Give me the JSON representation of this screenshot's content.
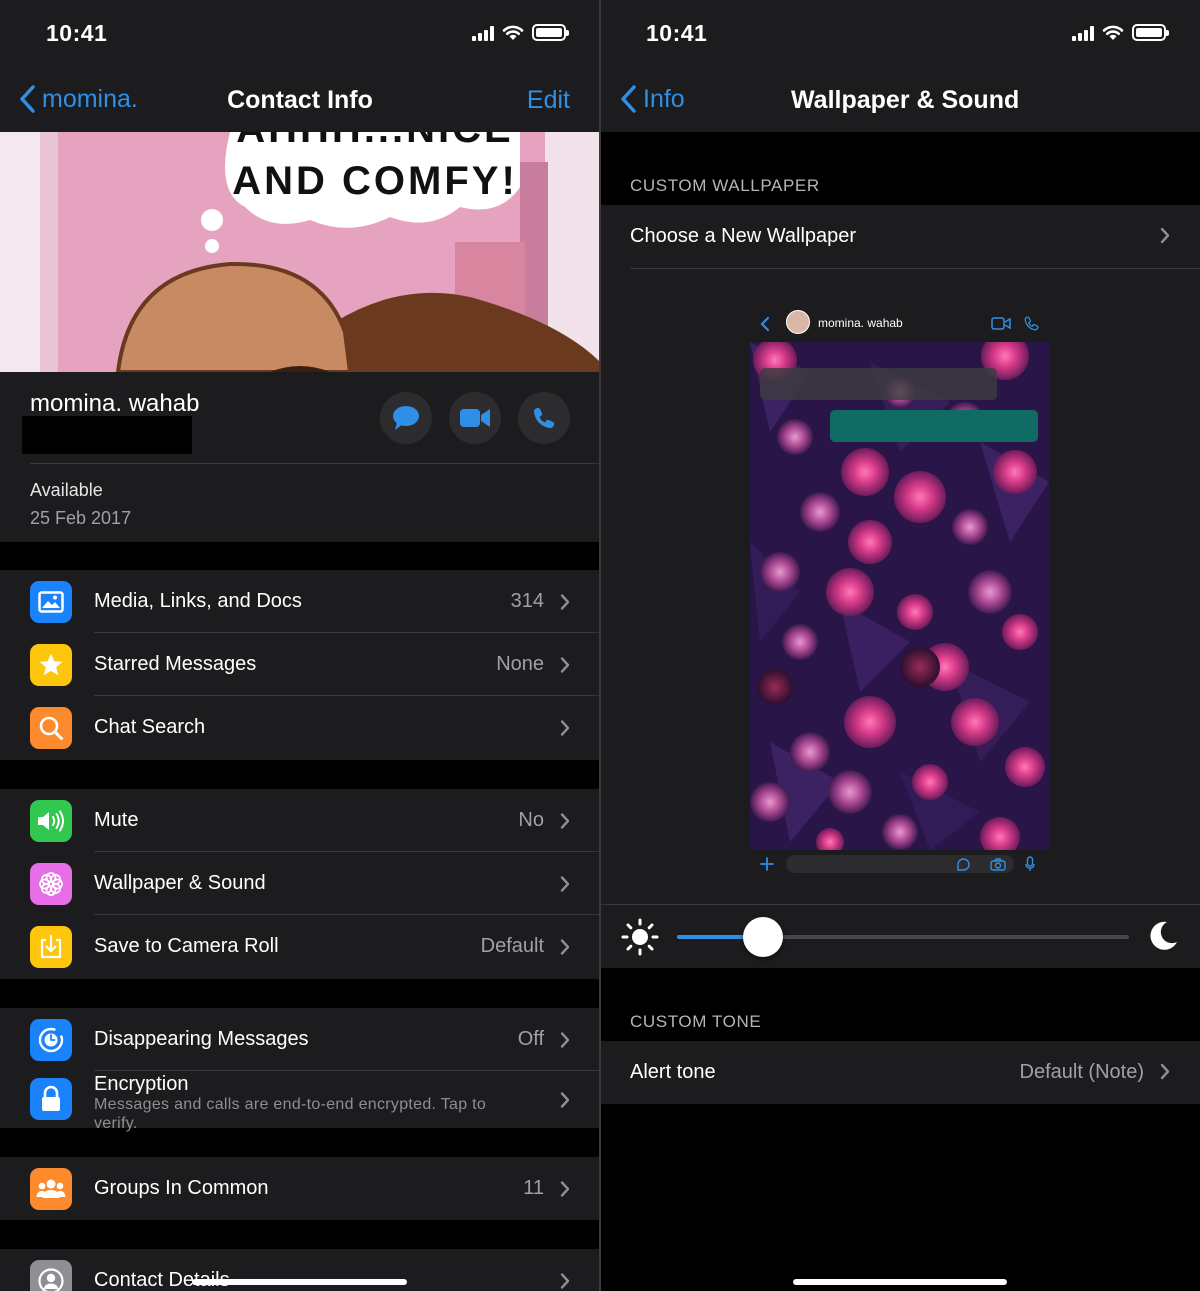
{
  "left": {
    "status": {
      "time": "10:41"
    },
    "nav": {
      "back_label": "momina.",
      "title": "Contact Info",
      "edit_label": "Edit"
    },
    "profile_image": {
      "caption_line1": "AHHH...NICE",
      "caption_line2": "AND COMFY!"
    },
    "contact": {
      "name": "momina. wahab",
      "status": "Available",
      "status_date": "25 Feb 2017"
    },
    "groups": [
      [
        {
          "icon": "photo-icon",
          "color": "#1a82fb",
          "label": "Media, Links, and Docs",
          "value": "314"
        },
        {
          "icon": "star-icon",
          "color": "#fdc50b",
          "label": "Starred Messages",
          "value": "None"
        },
        {
          "icon": "search-icon",
          "color": "#fd8a2c",
          "label": "Chat Search",
          "value": ""
        }
      ],
      [
        {
          "icon": "speaker-icon",
          "color": "#32c84f",
          "label": "Mute",
          "value": "No"
        },
        {
          "icon": "flower-icon",
          "color": "#e86ee8",
          "label": "Wallpaper & Sound",
          "value": ""
        },
        {
          "icon": "save-icon",
          "color": "#fdc50b",
          "label": "Save to Camera Roll",
          "value": "Default"
        }
      ],
      [
        {
          "icon": "timer-icon",
          "color": "#1a82fb",
          "label": "Disappearing Messages",
          "value": "Off"
        },
        {
          "icon": "lock-icon",
          "color": "#1a82fb",
          "label": "Encryption",
          "sublabel": "Messages and calls are end-to-end encrypted. Tap to verify.",
          "value": ""
        }
      ],
      [
        {
          "icon": "group-icon",
          "color": "#fd8a2c",
          "label": "Groups In Common",
          "value": "11"
        }
      ],
      [
        {
          "icon": "person-icon",
          "color": "#8e8e93",
          "label": "Contact Details",
          "value": ""
        }
      ]
    ]
  },
  "right": {
    "status": {
      "time": "10:41"
    },
    "nav": {
      "back_label": "Info",
      "title": "Wallpaper & Sound"
    },
    "custom_wallpaper_header": "CUSTOM WALLPAPER",
    "choose_wallpaper_label": "Choose a New Wallpaper",
    "preview": {
      "contact_name": "momina. wahab"
    },
    "dimming": {
      "level": 0.19
    },
    "custom_tone_header": "CUSTOM TONE",
    "alert_tone": {
      "label": "Alert tone",
      "value": "Default (Note)"
    }
  },
  "colors": {
    "accent": "#2f8fe6",
    "cell_bg": "#1c1c1e",
    "separator": "#38383a"
  }
}
